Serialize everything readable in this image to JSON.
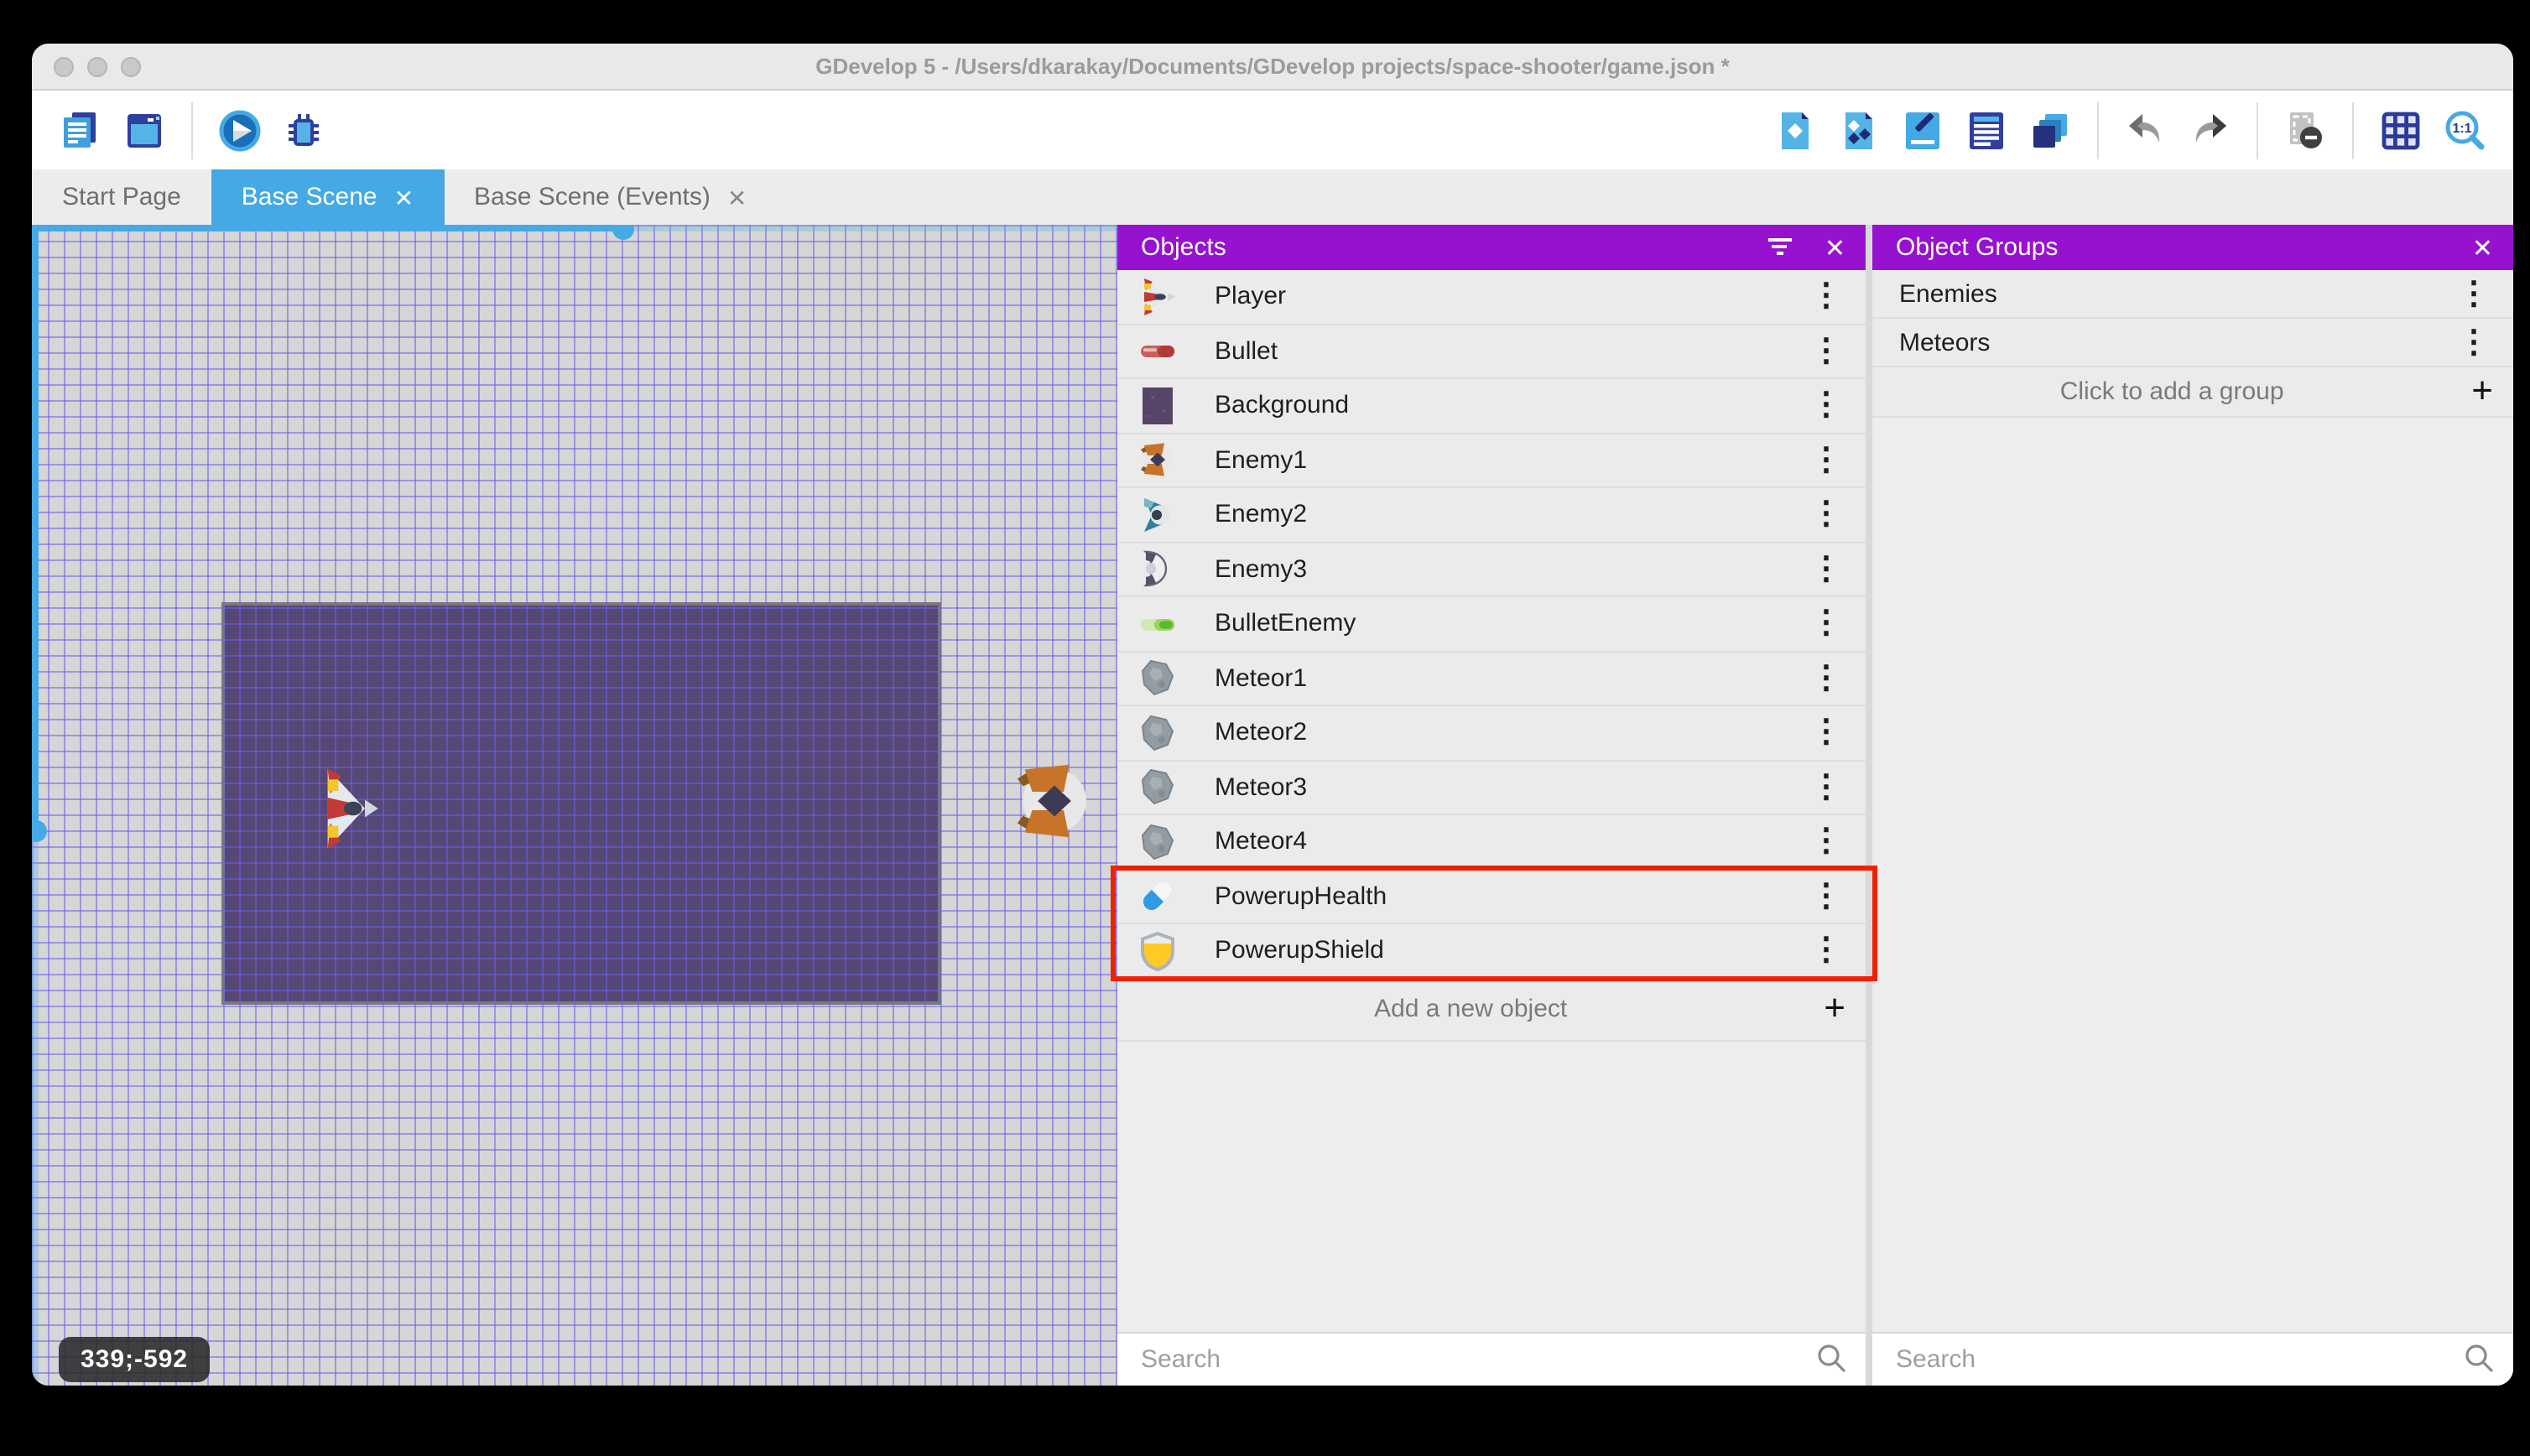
{
  "window": {
    "title": "GDevelop 5 - /Users/dkarakay/Documents/GDevelop projects/space-shooter/game.json *"
  },
  "toolbar": {
    "left_icons": [
      "project-manager",
      "preview-window",
      "play",
      "debug"
    ],
    "right_icons": [
      "objects-editor",
      "object-groups-editor",
      "properties",
      "instances-list",
      "layers",
      "undo",
      "redo",
      "mask-preview",
      "grid",
      "zoom-ratio"
    ],
    "zoom_label": "1:1"
  },
  "tabs": [
    {
      "label": "Start Page",
      "active": false,
      "closable": false
    },
    {
      "label": "Base Scene",
      "active": true,
      "closable": true
    },
    {
      "label": "Base Scene (Events)",
      "active": false,
      "closable": true
    }
  ],
  "canvas": {
    "coords_badge": "339;-592"
  },
  "objects_panel": {
    "title": "Objects",
    "items": [
      {
        "label": "Player",
        "icon": "player"
      },
      {
        "label": "Bullet",
        "icon": "bullet"
      },
      {
        "label": "Background",
        "icon": "background"
      },
      {
        "label": "Enemy1",
        "icon": "enemy1"
      },
      {
        "label": "Enemy2",
        "icon": "enemy2"
      },
      {
        "label": "Enemy3",
        "icon": "enemy3"
      },
      {
        "label": "BulletEnemy",
        "icon": "bulletenemy"
      },
      {
        "label": "Meteor1",
        "icon": "meteor"
      },
      {
        "label": "Meteor2",
        "icon": "meteor"
      },
      {
        "label": "Meteor3",
        "icon": "meteor"
      },
      {
        "label": "Meteor4",
        "icon": "meteor"
      },
      {
        "label": "PowerupHealth",
        "icon": "pill"
      },
      {
        "label": "PowerupShield",
        "icon": "shield"
      }
    ],
    "highlighted_items": [
      "PowerupHealth",
      "PowerupShield"
    ],
    "add_label": "Add a new object",
    "search_placeholder": "Search"
  },
  "object_groups_panel": {
    "title": "Object Groups",
    "items": [
      {
        "label": "Enemies"
      },
      {
        "label": "Meteors"
      }
    ],
    "add_label": "Click to add a group",
    "search_placeholder": "Search"
  },
  "colors": {
    "panel_header": "#9712ce",
    "active_tab": "#45a9e6",
    "selection_highlight": "#ee2200",
    "grid_line": "#6a62e9",
    "scene_background_object": "#574775"
  }
}
